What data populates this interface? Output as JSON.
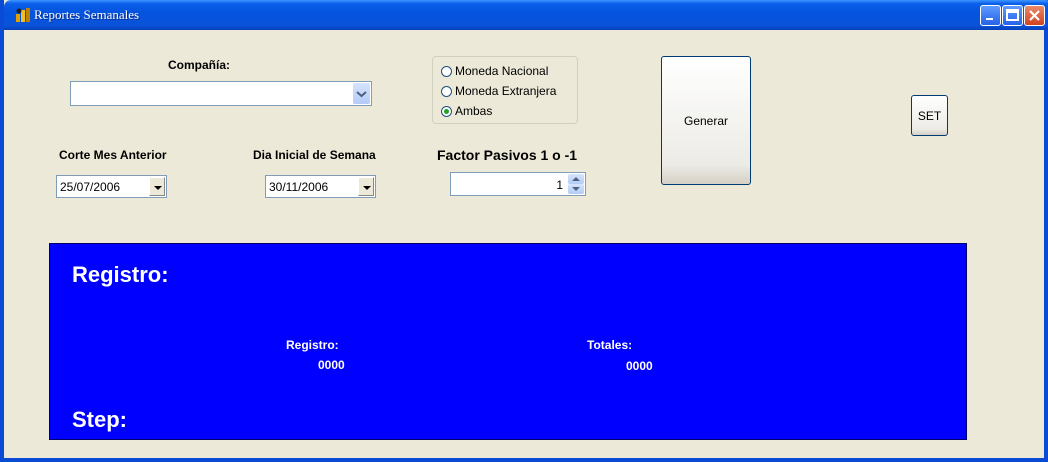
{
  "window": {
    "title": "Reportes Semanales"
  },
  "company": {
    "label": "Compañía:",
    "value": ""
  },
  "currency": {
    "options": [
      {
        "label": "Moneda Nacional",
        "checked": false
      },
      {
        "label": "Moneda Extranjera",
        "checked": false
      },
      {
        "label": "Ambas",
        "checked": true
      }
    ]
  },
  "generate_button": "Generar",
  "set_button": "SET",
  "corte": {
    "label": "Corte Mes Anterior",
    "value": "25/07/2006"
  },
  "dia_inicial": {
    "label": "Dia Inicial de Semana",
    "value": "30/11/2006"
  },
  "factor": {
    "label": "Factor Pasivos 1 o -1",
    "value": "1"
  },
  "status_panel": {
    "registro_heading": "Registro:",
    "step_heading": "Step:",
    "registro_label": "Registro:",
    "registro_value": "0000",
    "totales_label": "Totales:",
    "totales_value": "0000",
    "background": "#0000FF"
  }
}
